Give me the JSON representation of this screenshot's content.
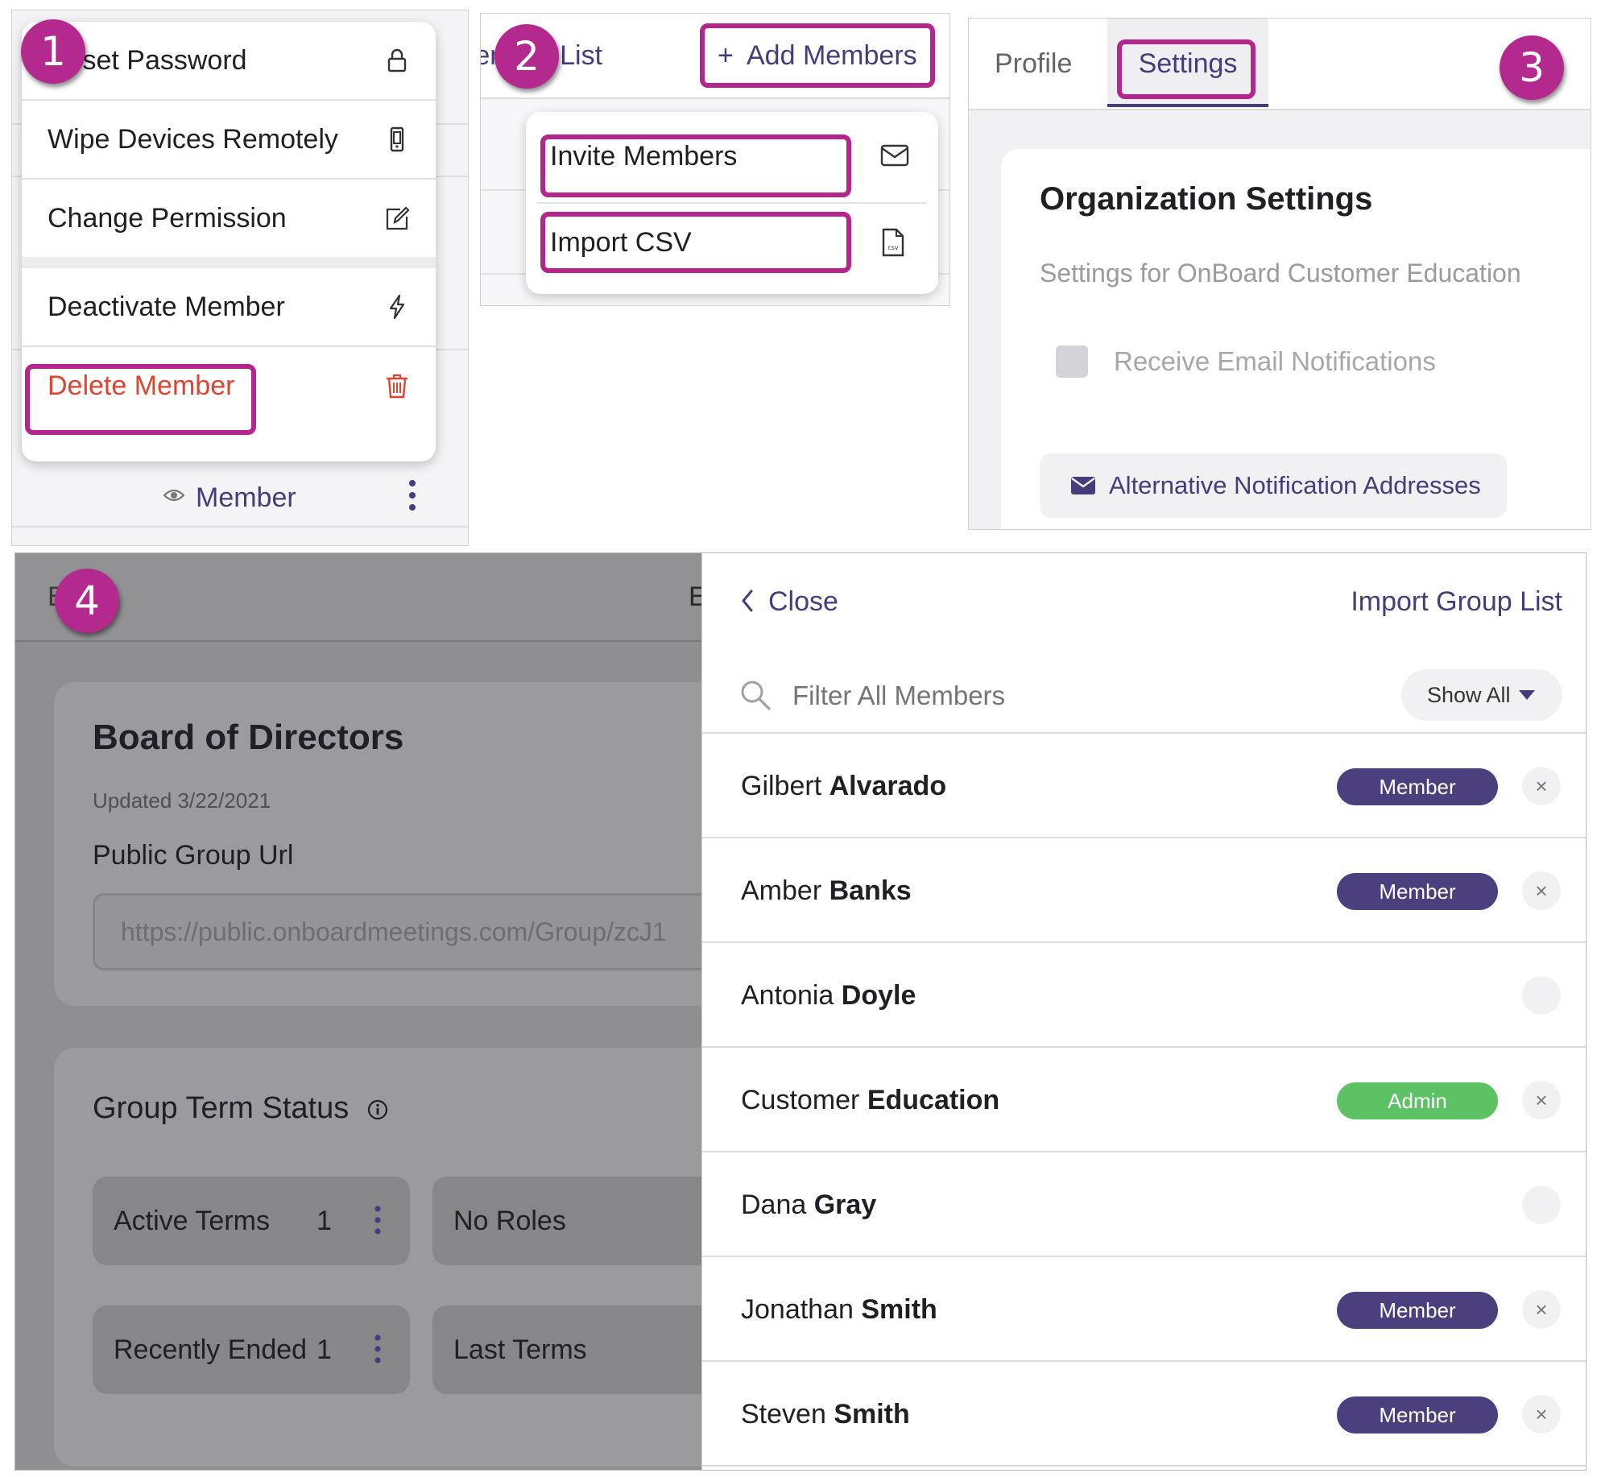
{
  "badges": {
    "one": "1",
    "two": "2",
    "three": "3",
    "four": "4"
  },
  "panel1": {
    "menu": [
      {
        "label": "Reset Password",
        "icon": "lock-icon"
      },
      {
        "label": "Wipe Devices Remotely",
        "icon": "mobile-device-icon"
      },
      {
        "label": "Change Permission",
        "icon": "edit-icon"
      },
      {
        "label": "Deactivate Member",
        "icon": "lightning-icon"
      },
      {
        "label": "Delete Member",
        "icon": "trash-icon"
      }
    ],
    "member_label": "Member",
    "danger_color": "#e0432f"
  },
  "panel2": {
    "member_list_tab": "Member List",
    "add_members": "Add Members",
    "dropdown": [
      {
        "label": "Invite Members",
        "icon": "envelope-icon"
      },
      {
        "label": "Import CSV",
        "icon": "csv-file-icon"
      }
    ]
  },
  "panel3": {
    "tabs": [
      "Profile",
      "Settings"
    ],
    "title": "Organization Settings",
    "subtitle": "Settings for OnBoard Customer Education",
    "checkbox_label": "Receive Email Notifications",
    "alt_button": "Alternative Notification Addresses"
  },
  "panel4": {
    "back_label": "Back",
    "header_fragment": "E",
    "group_title": "Board of Directors",
    "updated": "Updated 3/22/2021",
    "url_label": "Public Group Url",
    "url_value": "https://public.onboardmeetings.com/Group/zcJ1",
    "term_status_title": "Group Term Status",
    "terms": [
      {
        "label": "Active Terms",
        "count": "1"
      },
      {
        "label": "Recently Ended",
        "count": "1"
      }
    ],
    "terms_right": [
      "No Roles",
      "Last Terms"
    ],
    "drawer": {
      "close_label": "Close",
      "import_label": "Import Group List",
      "filter_placeholder": "Filter All Members",
      "show_all": "Show All",
      "members": [
        {
          "first": "Gilbert",
          "last": "Alvarado",
          "role": "Member"
        },
        {
          "first": "Amber",
          "last": "Banks",
          "role": "Member"
        },
        {
          "first": "Antonia",
          "last": "Doyle",
          "role": ""
        },
        {
          "first": "Customer",
          "last": "Education",
          "role": "Admin"
        },
        {
          "first": "Dana",
          "last": "Gray",
          "role": ""
        },
        {
          "first": "Jonathan",
          "last": "Smith",
          "role": "Member"
        },
        {
          "first": "Steven",
          "last": "Smith",
          "role": "Member"
        }
      ],
      "remove_glyph": "×"
    }
  },
  "colors": {
    "accent": "#463b7b",
    "highlight": "#b5268d",
    "member_pill": "#4b3f7e",
    "admin_pill": "#5cc264",
    "danger": "#e0432f"
  }
}
